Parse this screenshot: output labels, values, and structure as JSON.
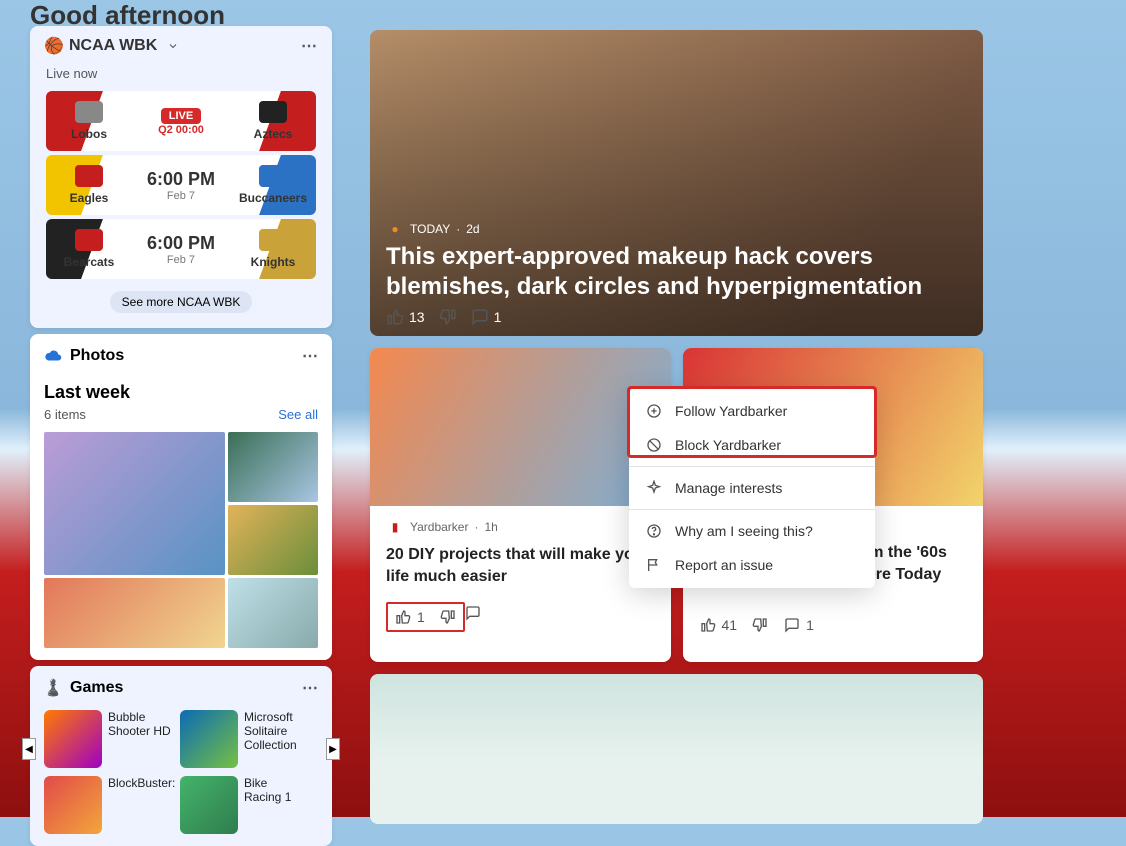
{
  "header": {
    "greeting": "Good afternoon"
  },
  "sports": {
    "league": "NCAA WBK",
    "live_now": "Live now",
    "see_more": "See more NCAA WBK",
    "games": [
      {
        "left_team": "Lobos",
        "right_team": "Aztecs",
        "live_badge": "LIVE",
        "sub": "Q2 00:00",
        "time": ""
      },
      {
        "left_team": "Eagles",
        "right_team": "Buccaneers",
        "time": "6:00 PM",
        "sub": "Feb 7"
      },
      {
        "left_team": "Bearcats",
        "right_team": "Knights",
        "time": "6:00 PM",
        "sub": "Feb 7"
      }
    ]
  },
  "photos": {
    "title": "Photos",
    "heading": "Last week",
    "count": "6 items",
    "see_all": "See all"
  },
  "games_widget": {
    "title": "Games",
    "items": [
      {
        "name": "Bubble Shooter HD"
      },
      {
        "name": "Microsoft Solitaire Collection"
      },
      {
        "name": "BlockBuster:"
      },
      {
        "name": "Bike Racing 1"
      }
    ]
  },
  "hero": {
    "source": "TODAY",
    "age": "2d",
    "title": "This expert-approved makeup hack covers blemishes, dark circles and hyperpigmentation",
    "likes": "13",
    "comments": "1"
  },
  "card_left": {
    "source": "Yardbarker",
    "age": "1h",
    "title": "20 DIY projects that will make your life much easier",
    "likes": "1"
  },
  "card_right": {
    "title_tail": "m the '60s That Are Still Everywhere Today",
    "likes": "41",
    "comments": "1"
  },
  "context_menu": {
    "follow": "Follow Yardbarker",
    "block": "Block Yardbarker",
    "manage": "Manage interests",
    "why": "Why am I seeing this?",
    "report": "Report an issue"
  }
}
